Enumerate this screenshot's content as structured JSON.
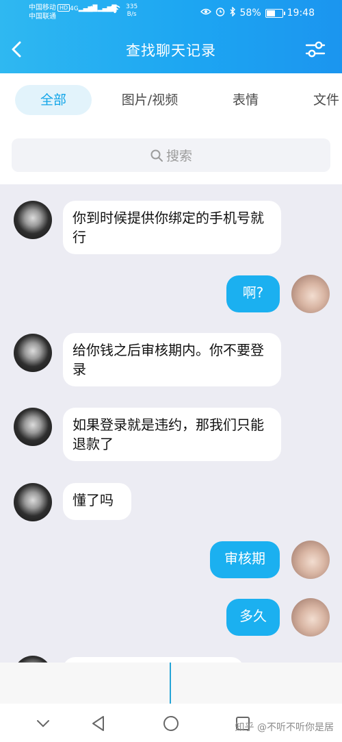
{
  "status_bar": {
    "carrier1": "中国移动",
    "hd": "HD",
    "carrier2": "中国联通",
    "net1": "4G",
    "net2": "4G",
    "speed_value": "335",
    "speed_unit": "B/s",
    "battery": "58%",
    "battery_level": 0.58,
    "time": "19:48"
  },
  "header": {
    "title": "查找聊天记录",
    "back_icon": "chevron-left-icon",
    "filter_icon": "sliders-icon"
  },
  "tabs": [
    {
      "label": "全部",
      "active": true
    },
    {
      "label": "图片/视频",
      "active": false
    },
    {
      "label": "表情",
      "active": false
    },
    {
      "label": "文件",
      "active": false
    }
  ],
  "search": {
    "placeholder": "搜索",
    "icon": "search-icon"
  },
  "messages": [
    {
      "side": "in",
      "text": "你到时候提供你绑定的手机号就行"
    },
    {
      "side": "out",
      "text": "啊?"
    },
    {
      "side": "in",
      "text": "给你钱之后审核期内。你不要登录"
    },
    {
      "side": "in",
      "text": "如果登录就是违约，那我们只能退款了"
    },
    {
      "side": "in",
      "text": "懂了吗"
    },
    {
      "side": "out",
      "text": "审核期"
    },
    {
      "side": "out",
      "text": "多久"
    }
  ],
  "navbar": {
    "icons": [
      "chevron-down-icon",
      "back-triangle-icon",
      "home-circle-icon",
      "recents-square-icon"
    ],
    "watermark": "知乎 @不听不听你是居"
  },
  "colors": {
    "header_start": "#2fb8f1",
    "header_end": "#1b95ef",
    "accent": "#12a5e8",
    "bubble_out": "#1bb0f0",
    "bubble_in": "#ffffff",
    "chat_bg": "#ececf3"
  }
}
